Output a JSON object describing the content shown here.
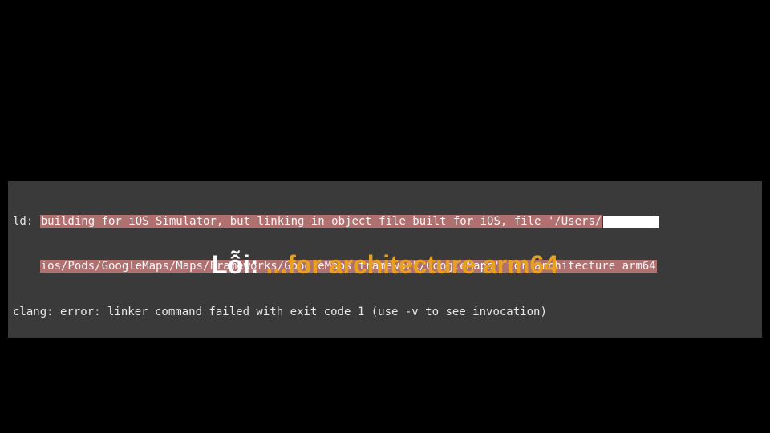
{
  "console": {
    "line1_prefix": "ld: ",
    "line1_hl": "building for iOS Simulator, but linking in object file built for iOS, file '/Users/",
    "line2_indent": "    ",
    "line2_hl": "ios/Pods/GoogleMaps/Maps/Frameworks/GoogleMaps.framework/GoogleMaps' for architecture arm64",
    "line3": "clang: error: linker command failed with exit code 1 (use -v to see invocation)"
  },
  "caption": {
    "prefix": "Lỗi: ",
    "main": "...for architecture arm64"
  }
}
